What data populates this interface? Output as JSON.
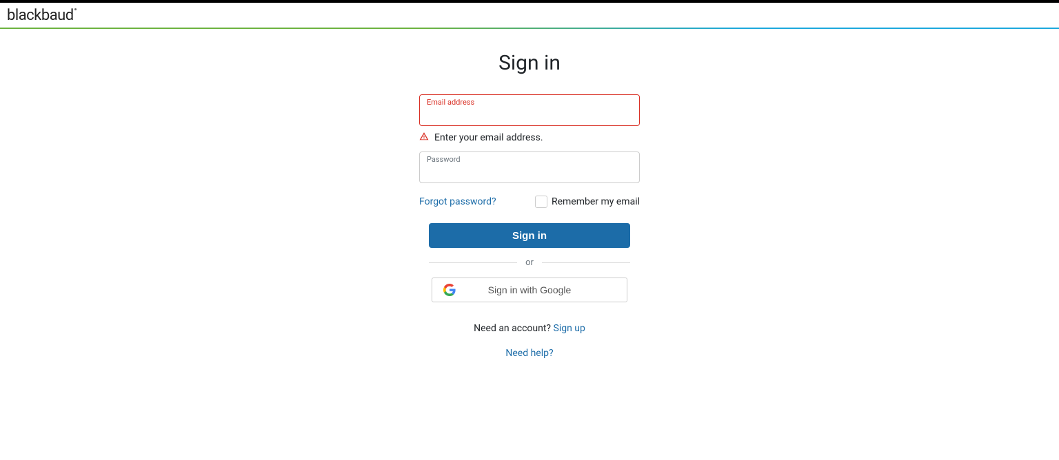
{
  "header": {
    "logo_text": "blackbaud"
  },
  "signin": {
    "title": "Sign in",
    "email_label": "Email address",
    "email_value": "",
    "email_error": "Enter your email address.",
    "password_label": "Password",
    "password_value": "",
    "forgot_label": "Forgot password?",
    "remember_label": "Remember my email",
    "submit_label": "Sign in",
    "divider_label": "or",
    "google_label": "Sign in with Google",
    "need_account_text": "Need an account? ",
    "signup_label": "Sign up",
    "need_help_label": "Need help?"
  }
}
